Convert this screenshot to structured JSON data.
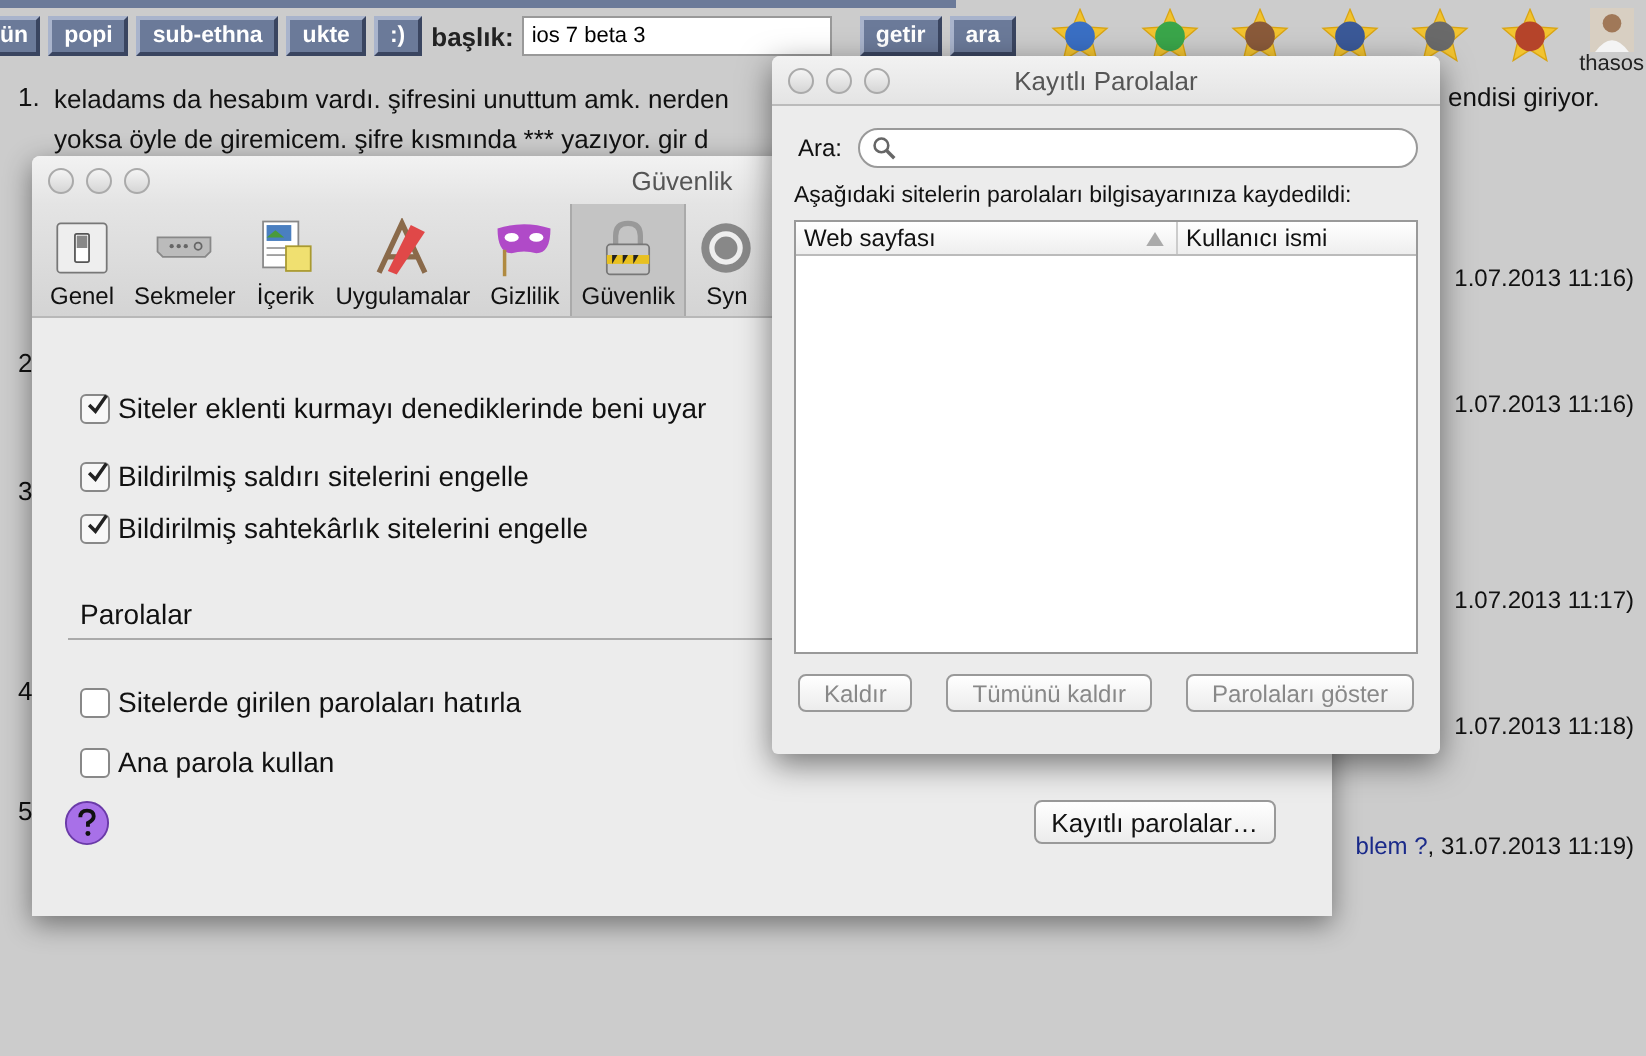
{
  "nav_buttons": [
    {
      "label": "ün"
    },
    {
      "label": "popi"
    },
    {
      "label": "sub-ethna"
    },
    {
      "label": "ukte"
    },
    {
      "label": ":)"
    }
  ],
  "title_field": {
    "label": "başlık:",
    "value": "ios 7 beta 3"
  },
  "action_buttons": [
    "getir",
    "ara"
  ],
  "user": {
    "name": "thasos"
  },
  "entries": [
    {
      "number": "1.",
      "lines": [
        "keladams da hesabım vardı. şifresini unuttum amk. nerden",
        "yoksa öyle de giremicem. şifre kısmında *** yazıyor. gir d"
      ],
      "right_text": "endisi giriyor.",
      "timestamp": "1.07.2013 11:16)"
    },
    {
      "number": "2",
      "timestamp": "1.07.2013 11:16)"
    },
    {
      "number": "3",
      "timestamp": "1.07.2013 11:17)"
    },
    {
      "number": "4",
      "timestamp": "1.07.2013 11:18)"
    },
    {
      "number": "5",
      "link": "blem ?",
      "timestamp": ", 31.07.2013 11:19)"
    }
  ],
  "preferences": {
    "title": "Güvenlik",
    "toolbar": [
      {
        "kind": "switch",
        "label": "Genel",
        "selected": false
      },
      {
        "kind": "tabs",
        "label": "Sekmeler",
        "selected": false
      },
      {
        "kind": "document",
        "label": "İçerik",
        "selected": false
      },
      {
        "kind": "tools",
        "label": "Uygulamalar",
        "selected": false
      },
      {
        "kind": "mask",
        "label": "Gizlilik",
        "selected": false
      },
      {
        "kind": "lock",
        "label": "Güvenlik",
        "selected": true
      },
      {
        "kind": "sync",
        "label": "Syn",
        "selected": false
      }
    ],
    "options": [
      {
        "label": "Siteler eklenti kurmayı denediklerinde beni uyar",
        "checked": true
      },
      {
        "label": "Bildirilmiş saldırı sitelerini engelle",
        "checked": true
      },
      {
        "label": "Bildirilmiş sahtekârlık sitelerini engelle",
        "checked": true
      }
    ],
    "section": "Parolalar",
    "password_options": [
      {
        "label": "Sitelerde girilen parolaları hatırla",
        "checked": false
      },
      {
        "label": "Ana parola kullan",
        "checked": false
      }
    ],
    "button": "Kayıtlı parolalar…"
  },
  "saved_passwords": {
    "title": "Kayıtlı Parolalar",
    "search_label": "Ara:",
    "description": "Aşağıdaki sitelerin parolaları bilgisayarınıza kaydedildi:",
    "columns": [
      "Web sayfası",
      "Kullanıcı ismi"
    ],
    "buttons": [
      {
        "label": "Kaldır",
        "disabled": true
      },
      {
        "label": "Tümünü kaldır",
        "disabled": true
      },
      {
        "label": "Parolaları göster",
        "disabled": true
      }
    ]
  }
}
